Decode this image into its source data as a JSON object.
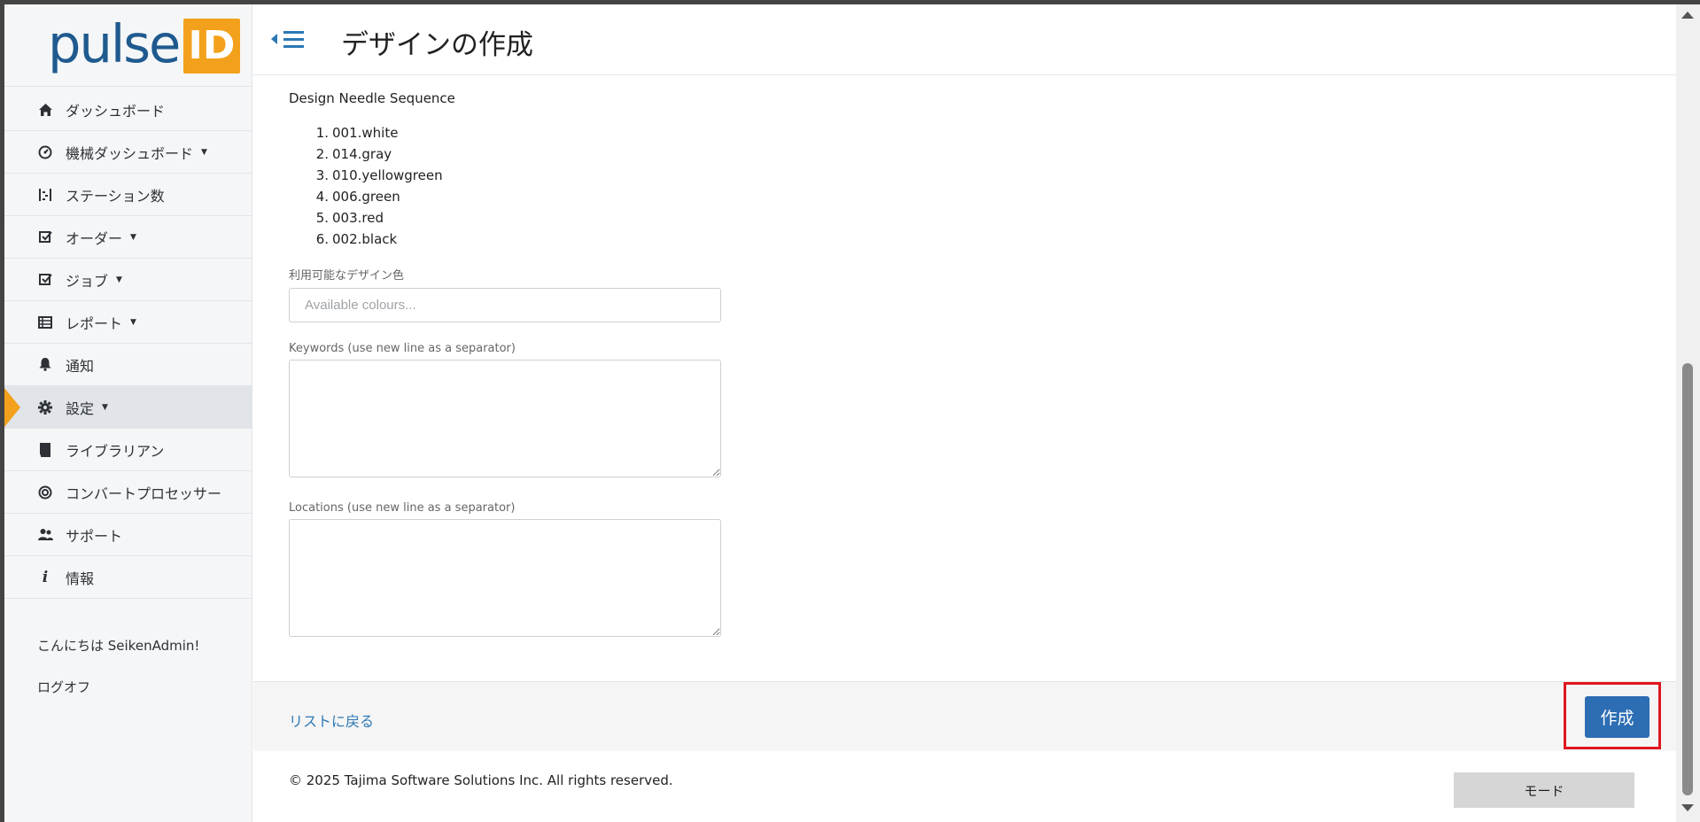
{
  "app": {
    "logo_text": "pulse",
    "logo_badge": "ID"
  },
  "header": {
    "title": "デザインの作成"
  },
  "sidebar": {
    "items": [
      {
        "label": "ダッシュボード",
        "icon": "home-icon",
        "has_caret": false
      },
      {
        "label": "機械ダッシュボード",
        "icon": "gauge-icon",
        "has_caret": true
      },
      {
        "label": "ステーション数",
        "icon": "stations-icon",
        "has_caret": false
      },
      {
        "label": "オーダー",
        "icon": "check-square-icon",
        "has_caret": true
      },
      {
        "label": "ジョブ",
        "icon": "check-square-icon",
        "has_caret": true
      },
      {
        "label": "レポート",
        "icon": "table-icon",
        "has_caret": true
      },
      {
        "label": "通知",
        "icon": "bell-icon",
        "has_caret": false
      },
      {
        "label": "設定",
        "icon": "gear-icon",
        "has_caret": true,
        "active": true
      },
      {
        "label": "ライブラリアン",
        "icon": "book-icon",
        "has_caret": false
      },
      {
        "label": "コンバートプロセッサー",
        "icon": "target-icon",
        "has_caret": false
      },
      {
        "label": "サポート",
        "icon": "users-icon",
        "has_caret": false
      },
      {
        "label": "情報",
        "icon": "info-icon",
        "has_caret": false
      }
    ],
    "greeting": "こんにちは SeikenAdmin!",
    "logout": "ログオフ"
  },
  "form": {
    "needle_section_title": "Design Needle Sequence",
    "needle_sequence": [
      {
        "num": "1.",
        "name": "001.white"
      },
      {
        "num": "2.",
        "name": "014.gray"
      },
      {
        "num": "3.",
        "name": "010.yellowgreen"
      },
      {
        "num": "4.",
        "name": "006.green"
      },
      {
        "num": "5.",
        "name": "003.red"
      },
      {
        "num": "6.",
        "name": "002.black"
      }
    ],
    "colours_label": "利用可能なデザイン色",
    "colours_placeholder": "Available colours...",
    "colours_value": "",
    "keywords_label": "Keywords (use new line as a separator)",
    "keywords_value": "",
    "locations_label": "Locations (use new line as a separator)",
    "locations_value": ""
  },
  "actions": {
    "back_link": "リストに戻る",
    "create_button": "作成"
  },
  "footer": {
    "copyright": "© 2025 Tajima Software Solutions Inc. All rights reserved.",
    "mode_button": "モード"
  },
  "colors": {
    "accent": "#f3a11d",
    "primary": "#2c6db3",
    "highlight": "#e0161e",
    "brand": "#1f5a8f"
  }
}
